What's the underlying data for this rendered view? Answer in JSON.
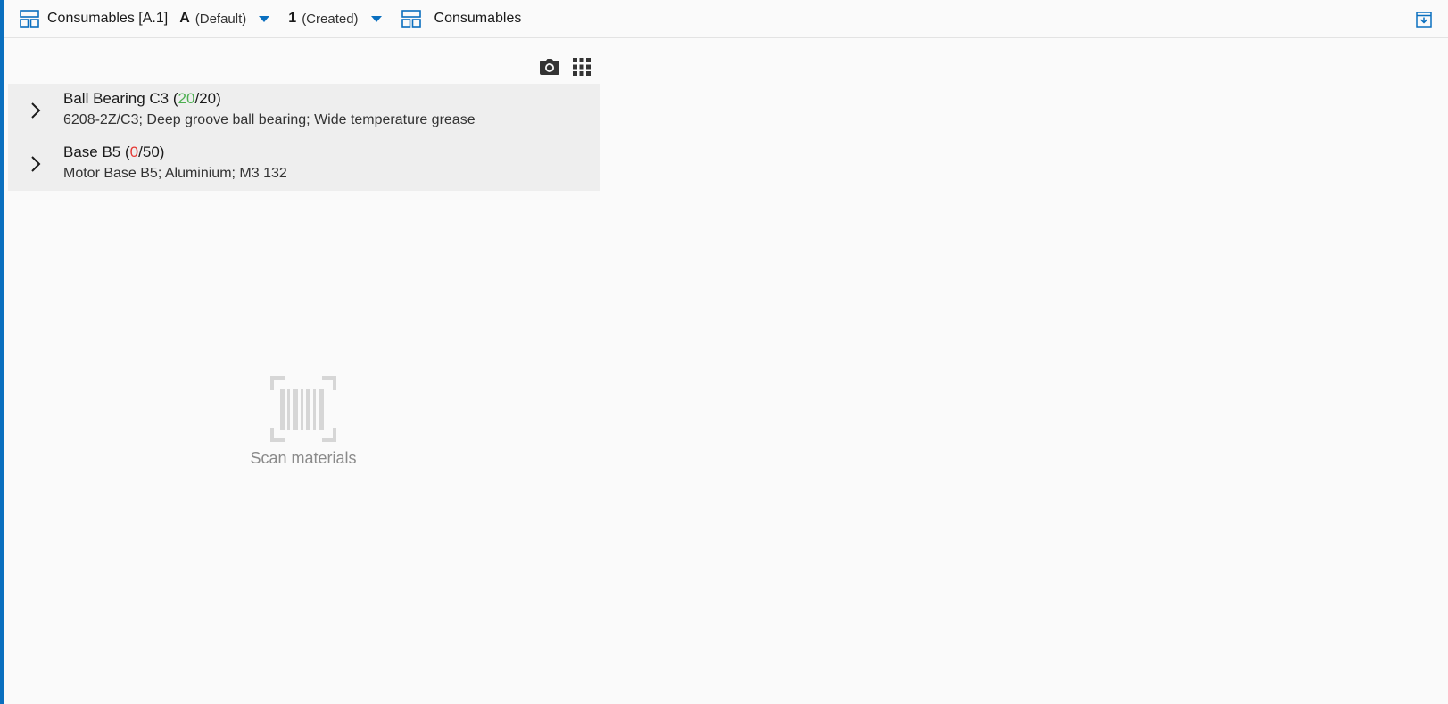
{
  "header": {
    "view_title": "Consumables [A.1]",
    "variant_code": "A",
    "variant_label": "(Default)",
    "status_code": "1",
    "status_label": "(Created)",
    "section_title": "Consumables"
  },
  "items": [
    {
      "name": "Ball Bearing C3",
      "scanned": "20",
      "total": "20",
      "description": "6208-2Z/C3; Deep groove ball bearing; Wide temperature grease"
    },
    {
      "name": "Base B5",
      "scanned": "0",
      "total": "50",
      "description": "Motor Base B5; Aluminium; M3 132"
    }
  ],
  "empty_state": {
    "label": "Scan materials",
    "icon": "barcode-scan-icon"
  },
  "icons": {
    "layout": "layout-icon",
    "caret": "caret-down-icon",
    "camera": "camera-icon",
    "grid": "grid-icon",
    "collapse": "collapse-panel-icon",
    "chevron": "chevron-right-icon"
  },
  "colors": {
    "accent": "#0a6fbf",
    "complete": "#4caf50",
    "incomplete": "#e53935"
  }
}
